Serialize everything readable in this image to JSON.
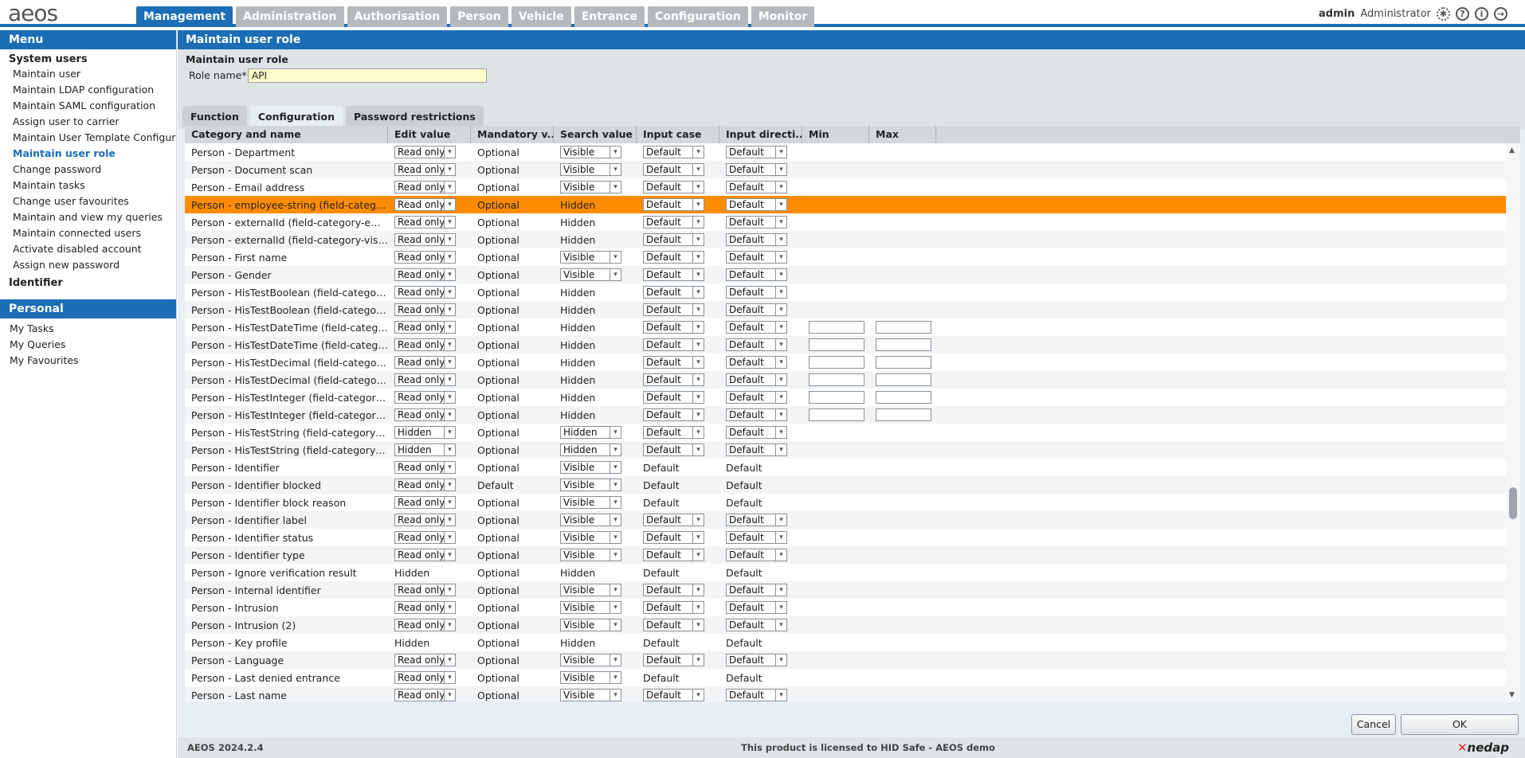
{
  "app": {
    "logo": "aeos",
    "user": "admin",
    "role": "Administrator"
  },
  "tabs": [
    "Management",
    "Administration",
    "Authorisation",
    "Person",
    "Vehicle",
    "Entrance",
    "Configuration",
    "Monitor"
  ],
  "active_tab": "Management",
  "sidebar": {
    "menu_title": "Menu",
    "groups": [
      {
        "title": "System users",
        "items": [
          "Maintain user",
          "Maintain LDAP configuration",
          "Maintain SAML configuration",
          "Assign user to carrier",
          "Maintain User Template Configuration",
          "Maintain user role",
          "Change password",
          "Maintain tasks",
          "Change user favourites",
          "Maintain and view my queries",
          "Maintain connected users",
          "Activate disabled account",
          "Assign new password"
        ]
      },
      {
        "title": "Identifier",
        "items": []
      }
    ],
    "active_item": "Maintain user role",
    "personal_title": "Personal",
    "personal_items": [
      "My Tasks",
      "My Queries",
      "My Favourites"
    ]
  },
  "page": {
    "title": "Maintain user role",
    "section_title": "Maintain user role",
    "role_label": "Role name*",
    "role_value": "API",
    "content_tabs": [
      "Function",
      "Configuration",
      "Password restrictions"
    ],
    "active_content_tab": "Configuration"
  },
  "grid": {
    "columns": [
      "Category and name",
      "Edit value",
      "Mandatory v...",
      "Search value",
      "Input case",
      "Input directi...",
      "Min",
      "Max"
    ],
    "rows": [
      {
        "name": "Person - Department",
        "edit": "Read only",
        "edit_sel": true,
        "mand": "Optional",
        "search": "Visible",
        "search_sel": true,
        "case": "Default",
        "case_sel": true,
        "dir": "Default",
        "dir_sel": true,
        "minmax": false
      },
      {
        "name": "Person - Document scan",
        "edit": "Read only",
        "edit_sel": true,
        "mand": "Optional",
        "search": "Visible",
        "search_sel": true,
        "case": "Default",
        "case_sel": true,
        "dir": "Default",
        "dir_sel": true,
        "minmax": false
      },
      {
        "name": "Person - Email address",
        "edit": "Read only",
        "edit_sel": true,
        "mand": "Optional",
        "search": "Visible",
        "search_sel": true,
        "case": "Default",
        "case_sel": true,
        "dir": "Default",
        "dir_sel": true,
        "minmax": false
      },
      {
        "name": "Person - employee-string (field-category-employee)",
        "edit": "Read only",
        "edit_sel": true,
        "mand": "Optional",
        "search": "Hidden",
        "search_sel": false,
        "case": "Default",
        "case_sel": true,
        "dir": "Default",
        "dir_sel": true,
        "minmax": false,
        "selected": true
      },
      {
        "name": "Person - externalId (field-category-employee)",
        "edit": "Read only",
        "edit_sel": true,
        "mand": "Optional",
        "search": "Hidden",
        "search_sel": false,
        "case": "Default",
        "case_sel": true,
        "dir": "Default",
        "dir_sel": true,
        "minmax": false
      },
      {
        "name": "Person - externalId (field-category-vistor)",
        "edit": "Read only",
        "edit_sel": true,
        "mand": "Optional",
        "search": "Hidden",
        "search_sel": false,
        "case": "Default",
        "case_sel": true,
        "dir": "Default",
        "dir_sel": true,
        "minmax": false
      },
      {
        "name": "Person - First name",
        "edit": "Read only",
        "edit_sel": true,
        "mand": "Optional",
        "search": "Visible",
        "search_sel": true,
        "case": "Default",
        "case_sel": true,
        "dir": "Default",
        "dir_sel": true,
        "minmax": false
      },
      {
        "name": "Person - Gender",
        "edit": "Read only",
        "edit_sel": true,
        "mand": "Optional",
        "search": "Visible",
        "search_sel": true,
        "case": "Default",
        "case_sel": true,
        "dir": "Default",
        "dir_sel": true,
        "minmax": false
      },
      {
        "name": "Person - HisTestBoolean (field-category-employee)",
        "edit": "Read only",
        "edit_sel": true,
        "mand": "Optional",
        "search": "Hidden",
        "search_sel": false,
        "case": "Default",
        "case_sel": true,
        "dir": "Default",
        "dir_sel": true,
        "minmax": false
      },
      {
        "name": "Person - HisTestBoolean (field-category-vistor)",
        "edit": "Read only",
        "edit_sel": true,
        "mand": "Optional",
        "search": "Hidden",
        "search_sel": false,
        "case": "Default",
        "case_sel": true,
        "dir": "Default",
        "dir_sel": true,
        "minmax": false
      },
      {
        "name": "Person - HisTestDateTime (field-category-employee)",
        "edit": "Read only",
        "edit_sel": true,
        "mand": "Optional",
        "search": "Hidden",
        "search_sel": false,
        "case": "Default",
        "case_sel": true,
        "dir": "Default",
        "dir_sel": true,
        "minmax": true
      },
      {
        "name": "Person - HisTestDateTime (field-category-vistor)",
        "edit": "Read only",
        "edit_sel": true,
        "mand": "Optional",
        "search": "Hidden",
        "search_sel": false,
        "case": "Default",
        "case_sel": true,
        "dir": "Default",
        "dir_sel": true,
        "minmax": true
      },
      {
        "name": "Person - HisTestDecimal (field-category-employee)",
        "edit": "Read only",
        "edit_sel": true,
        "mand": "Optional",
        "search": "Hidden",
        "search_sel": false,
        "case": "Default",
        "case_sel": true,
        "dir": "Default",
        "dir_sel": true,
        "minmax": true
      },
      {
        "name": "Person - HisTestDecimal (field-category-vistor)",
        "edit": "Read only",
        "edit_sel": true,
        "mand": "Optional",
        "search": "Hidden",
        "search_sel": false,
        "case": "Default",
        "case_sel": true,
        "dir": "Default",
        "dir_sel": true,
        "minmax": true
      },
      {
        "name": "Person - HisTestInteger (field-category-employee)",
        "edit": "Read only",
        "edit_sel": true,
        "mand": "Optional",
        "search": "Hidden",
        "search_sel": false,
        "case": "Default",
        "case_sel": true,
        "dir": "Default",
        "dir_sel": true,
        "minmax": true
      },
      {
        "name": "Person - HisTestInteger (field-category-vistor)",
        "edit": "Read only",
        "edit_sel": true,
        "mand": "Optional",
        "search": "Hidden",
        "search_sel": false,
        "case": "Default",
        "case_sel": true,
        "dir": "Default",
        "dir_sel": true,
        "minmax": true
      },
      {
        "name": "Person - HisTestString (field-category-employee)",
        "edit": "Hidden",
        "edit_sel": true,
        "mand": "Optional",
        "search": "Hidden",
        "search_sel": true,
        "case": "Default",
        "case_sel": true,
        "dir": "Default",
        "dir_sel": true,
        "minmax": false
      },
      {
        "name": "Person - HisTestString (field-category-vistor)",
        "edit": "Hidden",
        "edit_sel": true,
        "mand": "Optional",
        "search": "Hidden",
        "search_sel": true,
        "case": "Default",
        "case_sel": true,
        "dir": "Default",
        "dir_sel": true,
        "minmax": false
      },
      {
        "name": "Person - Identifier",
        "edit": "Read only",
        "edit_sel": true,
        "mand": "Optional",
        "search": "Visible",
        "search_sel": true,
        "case": "Default",
        "case_sel": false,
        "dir": "Default",
        "dir_sel": false,
        "minmax": false
      },
      {
        "name": "Person - Identifier blocked",
        "edit": "Read only",
        "edit_sel": true,
        "mand": "Default",
        "search": "Visible",
        "search_sel": true,
        "case": "Default",
        "case_sel": false,
        "dir": "Default",
        "dir_sel": false,
        "minmax": false
      },
      {
        "name": "Person - Identifier block reason",
        "edit": "Read only",
        "edit_sel": true,
        "mand": "Optional",
        "search": "Visible",
        "search_sel": true,
        "case": "Default",
        "case_sel": false,
        "dir": "Default",
        "dir_sel": false,
        "minmax": false
      },
      {
        "name": "Person - Identifier label",
        "edit": "Read only",
        "edit_sel": true,
        "mand": "Optional",
        "search": "Visible",
        "search_sel": true,
        "case": "Default",
        "case_sel": true,
        "dir": "Default",
        "dir_sel": true,
        "minmax": false
      },
      {
        "name": "Person - Identifier status",
        "edit": "Read only",
        "edit_sel": true,
        "mand": "Optional",
        "search": "Visible",
        "search_sel": true,
        "case": "Default",
        "case_sel": true,
        "dir": "Default",
        "dir_sel": true,
        "minmax": false
      },
      {
        "name": "Person - Identifier type",
        "edit": "Read only",
        "edit_sel": true,
        "mand": "Optional",
        "search": "Visible",
        "search_sel": true,
        "case": "Default",
        "case_sel": true,
        "dir": "Default",
        "dir_sel": true,
        "minmax": false
      },
      {
        "name": "Person - Ignore verification result",
        "edit": "Hidden",
        "edit_sel": false,
        "mand": "Optional",
        "search": "Hidden",
        "search_sel": false,
        "case": "Default",
        "case_sel": false,
        "dir": "Default",
        "dir_sel": false,
        "minmax": false
      },
      {
        "name": "Person - Internal identifier",
        "edit": "Read only",
        "edit_sel": true,
        "mand": "Optional",
        "search": "Visible",
        "search_sel": true,
        "case": "Default",
        "case_sel": true,
        "dir": "Default",
        "dir_sel": true,
        "minmax": false
      },
      {
        "name": "Person - Intrusion",
        "edit": "Read only",
        "edit_sel": true,
        "mand": "Optional",
        "search": "Visible",
        "search_sel": true,
        "case": "Default",
        "case_sel": true,
        "dir": "Default",
        "dir_sel": true,
        "minmax": false
      },
      {
        "name": "Person - Intrusion (2)",
        "edit": "Read only",
        "edit_sel": true,
        "mand": "Optional",
        "search": "Visible",
        "search_sel": true,
        "case": "Default",
        "case_sel": true,
        "dir": "Default",
        "dir_sel": true,
        "minmax": false
      },
      {
        "name": "Person - Key profile",
        "edit": "Hidden",
        "edit_sel": false,
        "mand": "Optional",
        "search": "Hidden",
        "search_sel": false,
        "case": "Default",
        "case_sel": false,
        "dir": "Default",
        "dir_sel": false,
        "minmax": false
      },
      {
        "name": "Person - Language",
        "edit": "Read only",
        "edit_sel": true,
        "mand": "Optional",
        "search": "Visible",
        "search_sel": true,
        "case": "Default",
        "case_sel": true,
        "dir": "Default",
        "dir_sel": true,
        "minmax": false
      },
      {
        "name": "Person - Last denied entrance",
        "edit": "Read only",
        "edit_sel": true,
        "mand": "Optional",
        "search": "Visible",
        "search_sel": true,
        "case": "Default",
        "case_sel": false,
        "dir": "Default",
        "dir_sel": false,
        "minmax": false
      },
      {
        "name": "Person - Last name",
        "edit": "Read only",
        "edit_sel": true,
        "mand": "Optional",
        "search": "Visible",
        "search_sel": true,
        "case": "Default",
        "case_sel": true,
        "dir": "Default",
        "dir_sel": true,
        "minmax": false
      }
    ]
  },
  "buttons": {
    "cancel": "Cancel",
    "ok": "OK"
  },
  "footer": {
    "version": "AEOS 2024.2.4",
    "license": "This product is licensed to HID Safe - AEOS demo",
    "brand": "nedap"
  },
  "colors": {
    "accent": "#1b6db5",
    "selected_row": "#ff8c00",
    "tab_inactive": "#b6b9bc"
  }
}
